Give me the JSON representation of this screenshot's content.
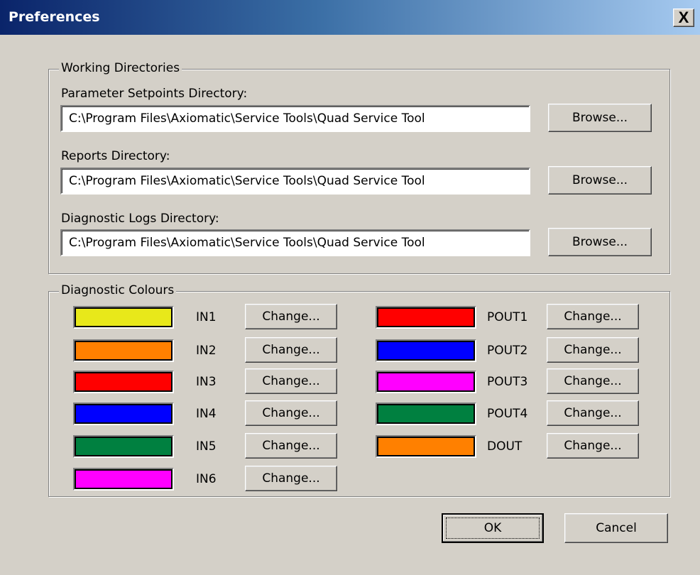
{
  "window": {
    "title": "Preferences",
    "close_glyph": "X",
    "close_icon": "close-icon"
  },
  "working_dirs": {
    "group_label": "Working Directories",
    "browse_label": "Browse...",
    "fields": [
      {
        "label": "Parameter Setpoints Directory:",
        "value": "C:\\Program Files\\Axiomatic\\Service Tools\\Quad Service Tool"
      },
      {
        "label": "Reports Directory:",
        "value": "C:\\Program Files\\Axiomatic\\Service Tools\\Quad Service Tool"
      },
      {
        "label": "Diagnostic Logs Directory:",
        "value": "C:\\Program Files\\Axiomatic\\Service Tools\\Quad Service Tool"
      }
    ]
  },
  "colours": {
    "group_label": "Diagnostic Colours",
    "change_label": "Change...",
    "left": [
      {
        "name": "IN1",
        "color": "#e8e81a"
      },
      {
        "name": "IN2",
        "color": "#ff8000"
      },
      {
        "name": "IN3",
        "color": "#ff0000"
      },
      {
        "name": "IN4",
        "color": "#0000ff"
      },
      {
        "name": "IN5",
        "color": "#008040"
      },
      {
        "name": "IN6",
        "color": "#ff00ff"
      }
    ],
    "right": [
      {
        "name": "POUT1",
        "color": "#ff0000"
      },
      {
        "name": "POUT2",
        "color": "#0000ff"
      },
      {
        "name": "POUT3",
        "color": "#ff00ff"
      },
      {
        "name": "POUT4",
        "color": "#008040"
      },
      {
        "name": "DOUT",
        "color": "#ff8000"
      }
    ]
  },
  "footer": {
    "ok_label": "OK",
    "cancel_label": "Cancel"
  }
}
